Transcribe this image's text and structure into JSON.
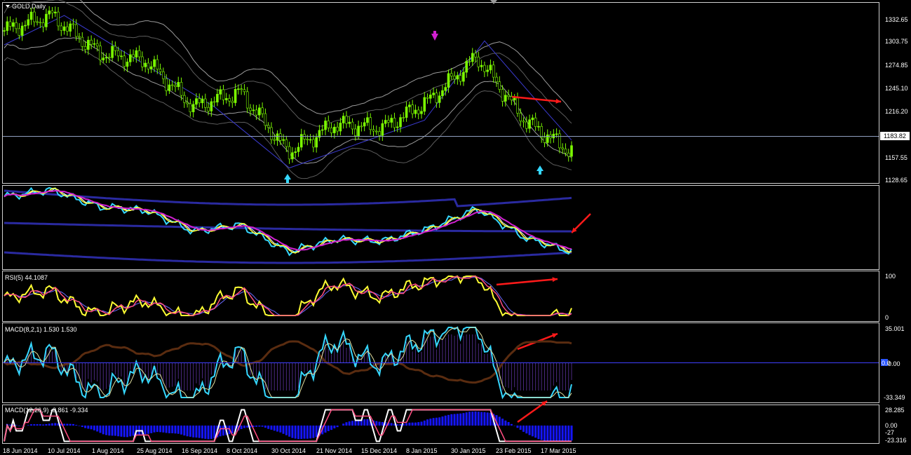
{
  "window": {
    "title": "GOLD,Daily"
  },
  "colors": {
    "background": "#000000",
    "bull_candle": "#7CFC00",
    "envelope": "#d0d0d0",
    "cyan": "#35d7ff",
    "yellow": "#ffff33",
    "magenta": "#d020d0",
    "navy": "#2a2aa0",
    "red_arrow": "#ff1a1a",
    "blue_hist": "#1515ff",
    "white": "#ffffff",
    "pink": "#ff4d80",
    "brown": "#5a2c10"
  },
  "price_axis": {
    "ticks": [
      "1332.65",
      "1303.75",
      "1274.85",
      "1245.10",
      "1216.20",
      "1183.82",
      "1157.55",
      "1128.65"
    ],
    "current": "1183.82"
  },
  "panels": {
    "rsi": {
      "label": "RSI(5) 44.1087",
      "ticks": [
        "100",
        "0"
      ]
    },
    "macd1": {
      "label": "MACD(8,2,1) 1.530 1.530",
      "ticks": [
        "35.001",
        "0.00",
        "-33.349"
      ],
      "flag": "0.0"
    },
    "macd2": {
      "label": "MACD(12,26,9) -3.861 -9.334",
      "ticks": [
        "28.285",
        "0.00",
        "-27",
        "-23.316"
      ]
    }
  },
  "time_axis": [
    "18 Jun 2014",
    "10 Jul 2014",
    "1 Aug 2014",
    "25 Aug 2014",
    "16 Sep 2014",
    "8 Oct 2014",
    "30 Oct 2014",
    "21 Nov 2014",
    "15 Dec 2014",
    "8 Jan 2015",
    "30 Jan 2015",
    "23 Feb 2015",
    "17 Mar 2015"
  ],
  "chart_data": {
    "type": "line",
    "title": "GOLD,Daily",
    "x": [
      "18 Jun 2014",
      "10 Jul 2014",
      "1 Aug 2014",
      "25 Aug 2014",
      "16 Sep 2014",
      "8 Oct 2014",
      "30 Oct 2014",
      "21 Nov 2014",
      "15 Dec 2014",
      "8 Jan 2015",
      "30 Jan 2015",
      "23 Feb 2015",
      "17 Mar 2015"
    ],
    "series": [
      {
        "values": [
          1318,
          1337,
          1290,
          1280,
          1222,
          1240,
          1165,
          1200,
          1195,
          1230,
          1285,
          1205,
          1165
        ]
      }
    ],
    "ylim": [
      1128.65,
      1332.65
    ],
    "grid": false
  }
}
